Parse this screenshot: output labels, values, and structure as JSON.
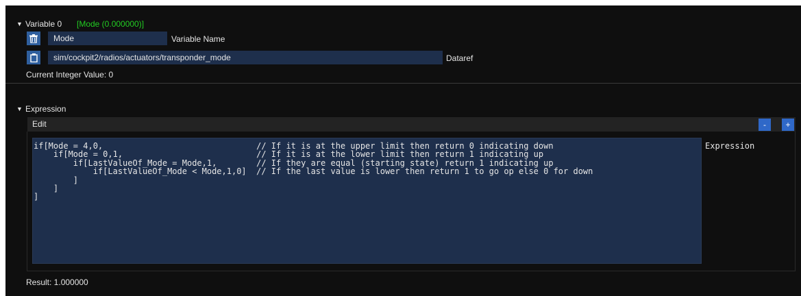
{
  "variable": {
    "header": "Variable 0",
    "status": "[Mode (0.000000)]",
    "status_color": "#22cc22",
    "name_value": "Mode",
    "name_label": "Variable Name",
    "dataref_value": "sim/cockpit2/radios/actuators/transponder_mode",
    "dataref_label": "Dataref",
    "current_value": "Current Integer Value: 0",
    "delete_icon": "trash-icon",
    "paste_icon": "clipboard-icon"
  },
  "expression": {
    "header": "Expression",
    "edit_label": "Edit",
    "minus_label": "-",
    "plus_label": "+",
    "code": "if[Mode = 4,0,                               // If it is at the upper limit then return 0 indicating down\n    if[Mode = 0,1,                           // If it is at the lower limit then return 1 indicating up\n        if[LastValueOf_Mode = Mode,1,        // If they are equal (starting state) return 1 indicating up\n            if[LastValueOf_Mode < Mode,1,0]  // If the last value is lower then return 1 to go op else 0 for down\n        ]\n    ]\n]",
    "field_label": "Expression",
    "result": "Result: 1.000000"
  },
  "colors": {
    "background": "#0f0f0f",
    "field": "#1e2f4c",
    "accent": "#2f68c8"
  }
}
